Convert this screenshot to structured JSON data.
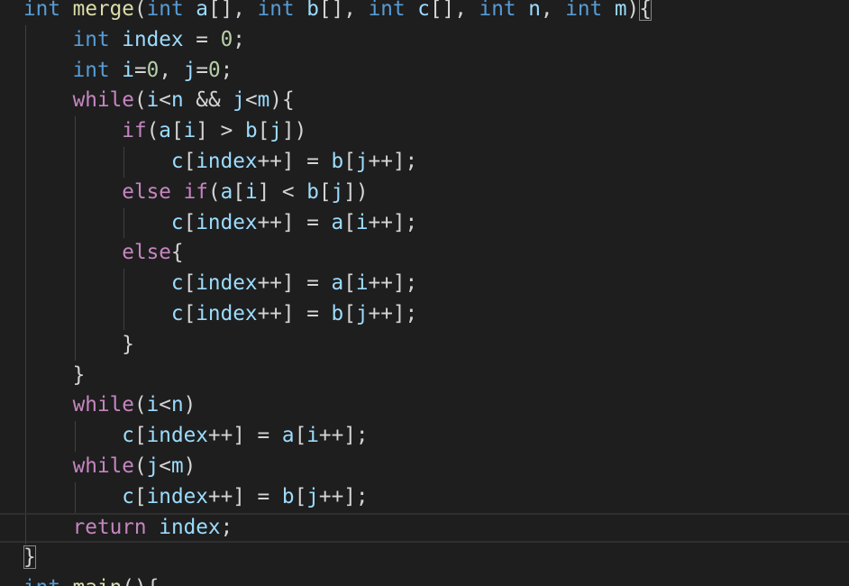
{
  "editor": {
    "language": "C",
    "theme_colors": {
      "background": "#1e1e1e",
      "keyword_type": "#569cd6",
      "keyword_control": "#c586c0",
      "function": "#dcdcaa",
      "variable": "#9cdcfe",
      "number": "#b5cea8",
      "text": "#d4d4d4"
    },
    "lines": [
      {
        "indent": 0,
        "tokens": [
          {
            "t": "int",
            "c": "kw-type"
          },
          {
            "t": " ",
            "c": "op"
          },
          {
            "t": "merge",
            "c": "fn"
          },
          {
            "t": "(",
            "c": "punct"
          },
          {
            "t": "int",
            "c": "kw-type"
          },
          {
            "t": " ",
            "c": "op"
          },
          {
            "t": "a",
            "c": "var"
          },
          {
            "t": "[], ",
            "c": "punct"
          },
          {
            "t": "int",
            "c": "kw-type"
          },
          {
            "t": " ",
            "c": "op"
          },
          {
            "t": "b",
            "c": "var"
          },
          {
            "t": "[], ",
            "c": "punct"
          },
          {
            "t": "int",
            "c": "kw-type"
          },
          {
            "t": " ",
            "c": "op"
          },
          {
            "t": "c",
            "c": "var"
          },
          {
            "t": "[], ",
            "c": "punct"
          },
          {
            "t": "int",
            "c": "kw-type"
          },
          {
            "t": " ",
            "c": "op"
          },
          {
            "t": "n",
            "c": "var"
          },
          {
            "t": ", ",
            "c": "punct"
          },
          {
            "t": "int",
            "c": "kw-type"
          },
          {
            "t": " ",
            "c": "op"
          },
          {
            "t": "m",
            "c": "var"
          },
          {
            "t": ")",
            "c": "punct"
          },
          {
            "t": "{",
            "c": "punct",
            "match": true
          }
        ]
      },
      {
        "indent": 1,
        "tokens": [
          {
            "t": "int",
            "c": "kw-type"
          },
          {
            "t": " ",
            "c": "op"
          },
          {
            "t": "index",
            "c": "var"
          },
          {
            "t": " = ",
            "c": "op"
          },
          {
            "t": "0",
            "c": "num"
          },
          {
            "t": ";",
            "c": "punct"
          }
        ]
      },
      {
        "indent": 1,
        "tokens": [
          {
            "t": "int",
            "c": "kw-type"
          },
          {
            "t": " ",
            "c": "op"
          },
          {
            "t": "i",
            "c": "var"
          },
          {
            "t": "=",
            "c": "op"
          },
          {
            "t": "0",
            "c": "num"
          },
          {
            "t": ", ",
            "c": "punct"
          },
          {
            "t": "j",
            "c": "var"
          },
          {
            "t": "=",
            "c": "op"
          },
          {
            "t": "0",
            "c": "num"
          },
          {
            "t": ";",
            "c": "punct"
          }
        ]
      },
      {
        "indent": 1,
        "tokens": [
          {
            "t": "while",
            "c": "kw-ctrl"
          },
          {
            "t": "(",
            "c": "punct"
          },
          {
            "t": "i",
            "c": "var"
          },
          {
            "t": "<",
            "c": "op"
          },
          {
            "t": "n",
            "c": "var"
          },
          {
            "t": " && ",
            "c": "op"
          },
          {
            "t": "j",
            "c": "var"
          },
          {
            "t": "<",
            "c": "op"
          },
          {
            "t": "m",
            "c": "var"
          },
          {
            "t": "){",
            "c": "punct"
          }
        ]
      },
      {
        "indent": 2,
        "tokens": [
          {
            "t": "if",
            "c": "kw-ctrl"
          },
          {
            "t": "(",
            "c": "punct"
          },
          {
            "t": "a",
            "c": "var"
          },
          {
            "t": "[",
            "c": "punct"
          },
          {
            "t": "i",
            "c": "var"
          },
          {
            "t": "] > ",
            "c": "punct"
          },
          {
            "t": "b",
            "c": "var"
          },
          {
            "t": "[",
            "c": "punct"
          },
          {
            "t": "j",
            "c": "var"
          },
          {
            "t": "])",
            "c": "punct"
          }
        ]
      },
      {
        "indent": 3,
        "tokens": [
          {
            "t": "c",
            "c": "var"
          },
          {
            "t": "[",
            "c": "punct"
          },
          {
            "t": "index",
            "c": "var"
          },
          {
            "t": "++] = ",
            "c": "op"
          },
          {
            "t": "b",
            "c": "var"
          },
          {
            "t": "[",
            "c": "punct"
          },
          {
            "t": "j",
            "c": "var"
          },
          {
            "t": "++];",
            "c": "op"
          }
        ]
      },
      {
        "indent": 2,
        "tokens": [
          {
            "t": "else",
            "c": "kw-ctrl"
          },
          {
            "t": " ",
            "c": "op"
          },
          {
            "t": "if",
            "c": "kw-ctrl"
          },
          {
            "t": "(",
            "c": "punct"
          },
          {
            "t": "a",
            "c": "var"
          },
          {
            "t": "[",
            "c": "punct"
          },
          {
            "t": "i",
            "c": "var"
          },
          {
            "t": "] < ",
            "c": "punct"
          },
          {
            "t": "b",
            "c": "var"
          },
          {
            "t": "[",
            "c": "punct"
          },
          {
            "t": "j",
            "c": "var"
          },
          {
            "t": "])",
            "c": "punct"
          }
        ]
      },
      {
        "indent": 3,
        "tokens": [
          {
            "t": "c",
            "c": "var"
          },
          {
            "t": "[",
            "c": "punct"
          },
          {
            "t": "index",
            "c": "var"
          },
          {
            "t": "++] = ",
            "c": "op"
          },
          {
            "t": "a",
            "c": "var"
          },
          {
            "t": "[",
            "c": "punct"
          },
          {
            "t": "i",
            "c": "var"
          },
          {
            "t": "++];",
            "c": "op"
          }
        ]
      },
      {
        "indent": 2,
        "tokens": [
          {
            "t": "else",
            "c": "kw-ctrl"
          },
          {
            "t": "{",
            "c": "punct"
          }
        ]
      },
      {
        "indent": 3,
        "tokens": [
          {
            "t": "c",
            "c": "var"
          },
          {
            "t": "[",
            "c": "punct"
          },
          {
            "t": "index",
            "c": "var"
          },
          {
            "t": "++] = ",
            "c": "op"
          },
          {
            "t": "a",
            "c": "var"
          },
          {
            "t": "[",
            "c": "punct"
          },
          {
            "t": "i",
            "c": "var"
          },
          {
            "t": "++];",
            "c": "op"
          }
        ]
      },
      {
        "indent": 3,
        "tokens": [
          {
            "t": "c",
            "c": "var"
          },
          {
            "t": "[",
            "c": "punct"
          },
          {
            "t": "index",
            "c": "var"
          },
          {
            "t": "++] = ",
            "c": "op"
          },
          {
            "t": "b",
            "c": "var"
          },
          {
            "t": "[",
            "c": "punct"
          },
          {
            "t": "j",
            "c": "var"
          },
          {
            "t": "++];",
            "c": "op"
          }
        ]
      },
      {
        "indent": 2,
        "tokens": [
          {
            "t": "}",
            "c": "punct"
          }
        ]
      },
      {
        "indent": 1,
        "tokens": [
          {
            "t": "}",
            "c": "punct"
          }
        ]
      },
      {
        "indent": 1,
        "tokens": [
          {
            "t": "while",
            "c": "kw-ctrl"
          },
          {
            "t": "(",
            "c": "punct"
          },
          {
            "t": "i",
            "c": "var"
          },
          {
            "t": "<",
            "c": "op"
          },
          {
            "t": "n",
            "c": "var"
          },
          {
            "t": ")",
            "c": "punct"
          }
        ]
      },
      {
        "indent": 2,
        "tokens": [
          {
            "t": "c",
            "c": "var"
          },
          {
            "t": "[",
            "c": "punct"
          },
          {
            "t": "index",
            "c": "var"
          },
          {
            "t": "++] = ",
            "c": "op"
          },
          {
            "t": "a",
            "c": "var"
          },
          {
            "t": "[",
            "c": "punct"
          },
          {
            "t": "i",
            "c": "var"
          },
          {
            "t": "++];",
            "c": "op"
          }
        ]
      },
      {
        "indent": 1,
        "tokens": [
          {
            "t": "while",
            "c": "kw-ctrl"
          },
          {
            "t": "(",
            "c": "punct"
          },
          {
            "t": "j",
            "c": "var"
          },
          {
            "t": "<",
            "c": "op"
          },
          {
            "t": "m",
            "c": "var"
          },
          {
            "t": ")",
            "c": "punct"
          }
        ]
      },
      {
        "indent": 2,
        "tokens": [
          {
            "t": "c",
            "c": "var"
          },
          {
            "t": "[",
            "c": "punct"
          },
          {
            "t": "index",
            "c": "var"
          },
          {
            "t": "++] = ",
            "c": "op"
          },
          {
            "t": "b",
            "c": "var"
          },
          {
            "t": "[",
            "c": "punct"
          },
          {
            "t": "j",
            "c": "var"
          },
          {
            "t": "++];",
            "c": "op"
          }
        ]
      },
      {
        "indent": 1,
        "current": true,
        "tokens": [
          {
            "t": "return",
            "c": "kw-ctrl"
          },
          {
            "t": " ",
            "c": "op"
          },
          {
            "t": "index",
            "c": "var"
          },
          {
            "t": ";",
            "c": "punct"
          }
        ]
      },
      {
        "indent": 0,
        "tokens": [
          {
            "t": "}",
            "c": "punct",
            "match": true
          }
        ]
      },
      {
        "indent": 0,
        "tokens": [
          {
            "t": "int",
            "c": "kw-type"
          },
          {
            "t": " ",
            "c": "op"
          },
          {
            "t": "main",
            "c": "fn"
          },
          {
            "t": "(){",
            "c": "punct"
          }
        ]
      }
    ]
  }
}
